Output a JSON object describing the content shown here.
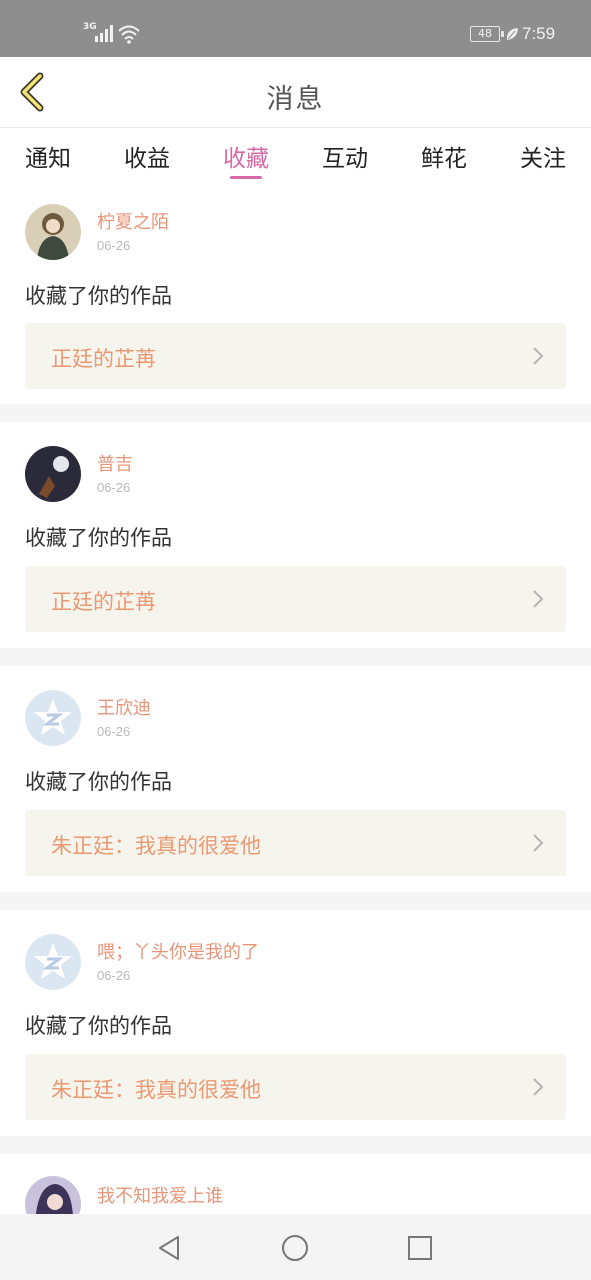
{
  "status_bar": {
    "network": "3G",
    "battery": "48",
    "time": "7:59",
    "icons": [
      "signal-icon",
      "wifi-icon",
      "battery-icon",
      "leaf-icon"
    ]
  },
  "header": {
    "title": "消息",
    "back_icon": "back-chevron-icon"
  },
  "tabs": [
    {
      "label": "通知"
    },
    {
      "label": "收益"
    },
    {
      "label": "收藏"
    },
    {
      "label": "互动"
    },
    {
      "label": "鲜花"
    },
    {
      "label": "关注"
    }
  ],
  "active_tab": "收藏",
  "items": [
    {
      "name": "柠夏之陌",
      "date": "06-26",
      "action": "收藏了你的作品",
      "work": "正廷的芷苒",
      "avatar": "photo"
    },
    {
      "name": "普吉",
      "date": "06-26",
      "action": "收藏了你的作品",
      "work": "正廷的芷苒",
      "avatar": "photo"
    },
    {
      "name": "王欣迪",
      "date": "06-26",
      "action": "收藏了你的作品",
      "work": "朱正廷：我真的很爱他",
      "avatar": "default"
    },
    {
      "name": "喂；丫头你是我的了",
      "date": "06-26",
      "action": "收藏了你的作品",
      "work": "朱正廷：我真的很爱他",
      "avatar": "default"
    },
    {
      "name": "我不知我爱上谁",
      "avatar": "photo"
    }
  ],
  "colors": {
    "accent": "#d66aa6",
    "username": "#e8957a",
    "work_title": "#ec9871",
    "work_bg": "#f5f5ee",
    "status_bar": "#8e8e8e"
  },
  "nav": {
    "icons": [
      "back-triangle-icon",
      "home-circle-icon",
      "recents-square-icon"
    ]
  }
}
